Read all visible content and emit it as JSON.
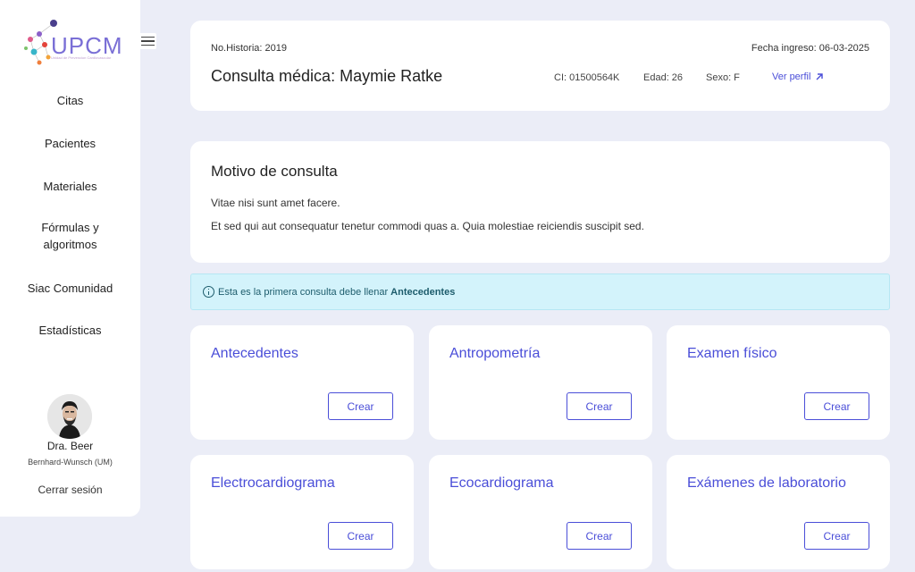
{
  "sidebar": {
    "logo_text": "UPCM",
    "logo_subtext": "Unidad de Prevencion Cardiovascular",
    "items": [
      {
        "label": "Citas"
      },
      {
        "label": "Pacientes"
      },
      {
        "label": "Materiales"
      },
      {
        "label": "Fórmulas y algoritmos"
      },
      {
        "label": "Siac Comunidad"
      },
      {
        "label": "Estadísticas"
      }
    ],
    "user": {
      "name": "Dra. Beer",
      "org": "Bernhard-Wunsch (UM)"
    },
    "logout_label": "Cerrar sesión"
  },
  "header": {
    "historia": "No.Historia: 2019",
    "fecha_ingreso": "Fecha ingreso: 06-03-2025",
    "title": "Consulta médica: Maymie Ratke",
    "ci": "CI: 01500564K",
    "edad": "Edad: 26",
    "sexo": "Sexo: F",
    "ver_perfil": "Ver perfil"
  },
  "motivo": {
    "title": "Motivo de consulta",
    "line1": "Vitae nisi sunt amet facere.",
    "line2": "Et sed qui aut consequatur tenetur commodi quas a. Quia molestiae reiciendis suscipit sed."
  },
  "alert": {
    "text": "Esta es la primera consulta debe llenar",
    "bold": "Antecedentes",
    "icon": "info-icon"
  },
  "sections": [
    {
      "title": "Antecedentes",
      "button": "Crear"
    },
    {
      "title": "Antropometría",
      "button": "Crear"
    },
    {
      "title": "Examen físico",
      "button": "Crear"
    },
    {
      "title": "Electrocardiograma",
      "button": "Crear"
    },
    {
      "title": "Ecocardiograma",
      "button": "Crear"
    },
    {
      "title": "Exámenes de laboratorio",
      "button": "Crear"
    }
  ],
  "colors": {
    "accent": "#4a4ed8",
    "background": "#ebedf7",
    "alert_bg": "#d3f3fb"
  }
}
